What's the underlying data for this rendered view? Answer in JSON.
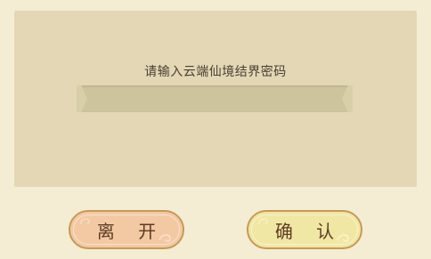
{
  "dialog": {
    "prompt": "请输入云端仙境结界密码",
    "password_input": {
      "value": "",
      "placeholder": ""
    },
    "buttons": {
      "leave_label": "离 开",
      "confirm_label": "确 认"
    },
    "colors": {
      "background": "#f4ecd3",
      "panel": "#e3d7b5",
      "input": "#cdc49d",
      "leave_button": "#f3c9a4",
      "confirm_button": "#f1e7a4",
      "button_border": "#c59a58",
      "text": "#4a3f33"
    }
  }
}
